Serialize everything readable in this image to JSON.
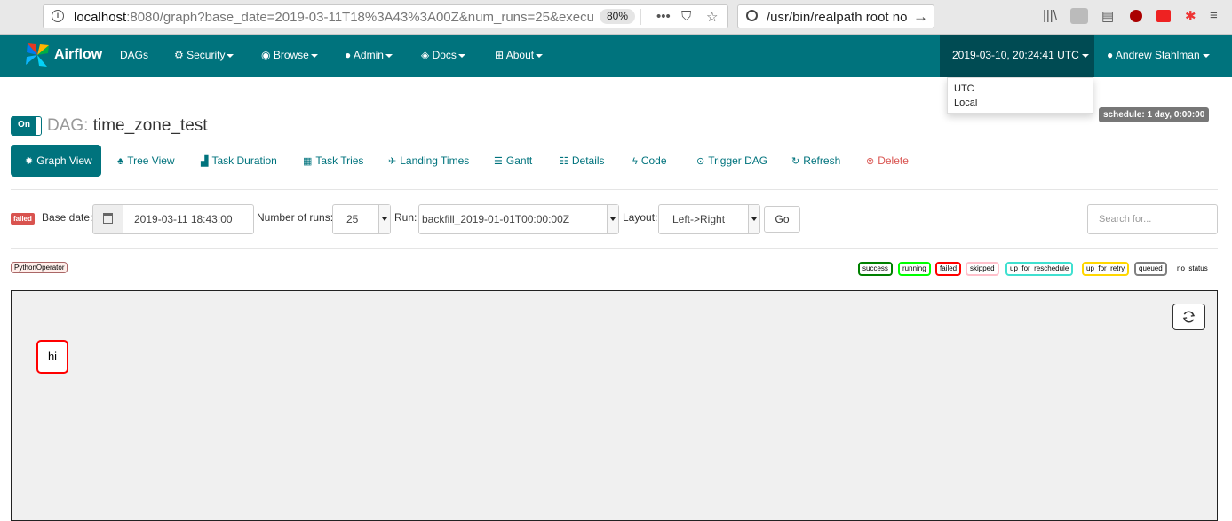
{
  "browser": {
    "url_host": "localhost",
    "url_rest": ":8080/graph?base_date=2019-03-11T18%3A43%3A00Z&num_runs=25&execu",
    "zoom": "80%",
    "search_value": "/usr/bin/realpath root no s"
  },
  "navbar": {
    "brand": "Airflow",
    "items": [
      "DAGs",
      "Security",
      "Browse",
      "Admin",
      "Docs",
      "About"
    ],
    "clock": "2019-03-10, 20:24:41 UTC",
    "user": "Andrew Stahlman",
    "accent": "#00737d"
  },
  "tz_dropdown": {
    "options": [
      "UTC",
      "Local"
    ]
  },
  "dag": {
    "toggle": "On",
    "label": "DAG:",
    "name": "time_zone_test",
    "schedule": "schedule: 1 day, 0:00:00"
  },
  "tabs": [
    "Graph View",
    "Tree View",
    "Task Duration",
    "Task Tries",
    "Landing Times",
    "Gantt",
    "Details",
    "Code",
    "Trigger DAG",
    "Refresh",
    "Delete"
  ],
  "form": {
    "state_badge": "failed",
    "base_date_label": "Base date:",
    "base_date": "2019-03-11 18:43:00",
    "runs_label": "Number of runs:",
    "runs": "25",
    "run_label": "Run:",
    "run": "backfill_2019-01-01T00:00:00Z",
    "layout_label": "Layout:",
    "layout": "Left->Right",
    "go": "Go",
    "search_placeholder": "Search for..."
  },
  "operator": "PythonOperator",
  "legend": [
    {
      "label": "success",
      "color": "#008000"
    },
    {
      "label": "running",
      "color": "#00ff00"
    },
    {
      "label": "failed",
      "color": "#ff0000"
    },
    {
      "label": "skipped",
      "color": "#ffc0cb"
    },
    {
      "label": "up_for_reschedule",
      "color": "#40e0d0"
    },
    {
      "label": "up_for_retry",
      "color": "#ffd700"
    },
    {
      "label": "queued",
      "color": "#808080"
    },
    {
      "label": "no_status",
      "color": "#ffffff"
    }
  ],
  "graph": {
    "node": "hi"
  }
}
